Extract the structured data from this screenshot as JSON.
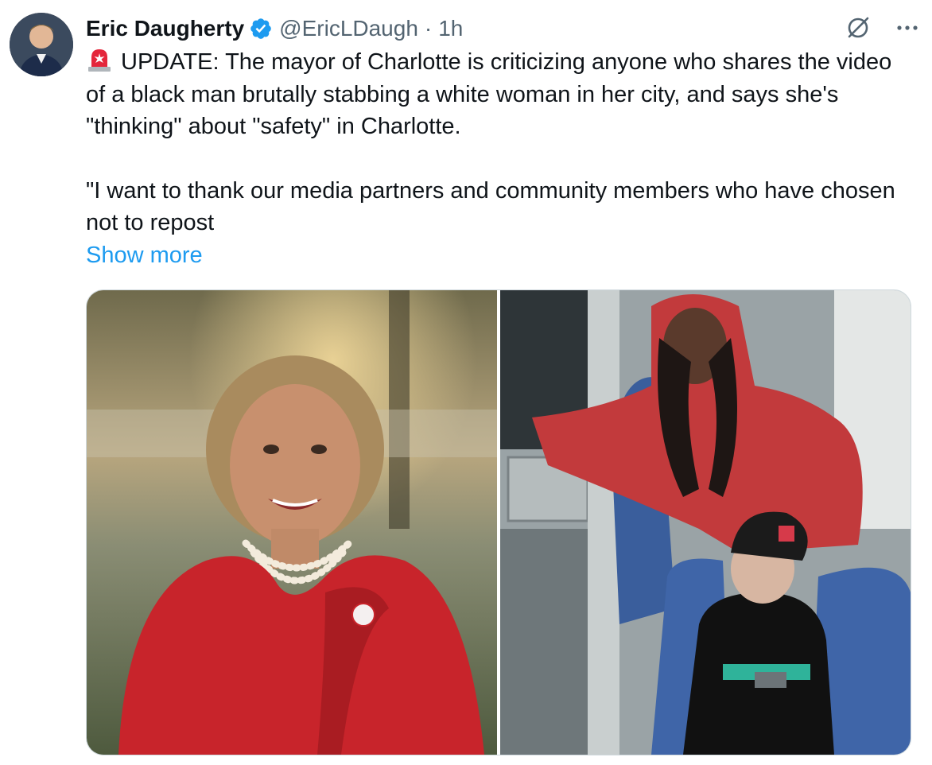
{
  "author": {
    "name": "Eric Daugherty",
    "handle": "@EricLDaugh",
    "separator": "·",
    "time": "1h",
    "avatar_icon": "avatar",
    "verified_icon": "verified-badge-icon",
    "verified_color": "#1d9bf0"
  },
  "actions": {
    "grok_icon": "grok-icon",
    "more_icon": "more-icon"
  },
  "tweet": {
    "siren_icon": "police-light-icon",
    "line1": "UPDATE: The mayor of Charlotte is criticizing anyone who shares the video of a black man brutally stabbing a white woman in her city, and says she's \"thinking\" about \"safety\" in Charlotte.",
    "line2": "\"I want to thank our media partners and community members who have chosen not to repost",
    "show_more": "Show more"
  },
  "colors": {
    "text": "#0f1419",
    "secondary": "#536471",
    "link": "#1d9bf0",
    "border": "#cfd9de"
  },
  "media": {
    "images": [
      {
        "description_icon": "photo-woman-red-dress"
      },
      {
        "description_icon": "photo-train-surveillance"
      }
    ]
  }
}
